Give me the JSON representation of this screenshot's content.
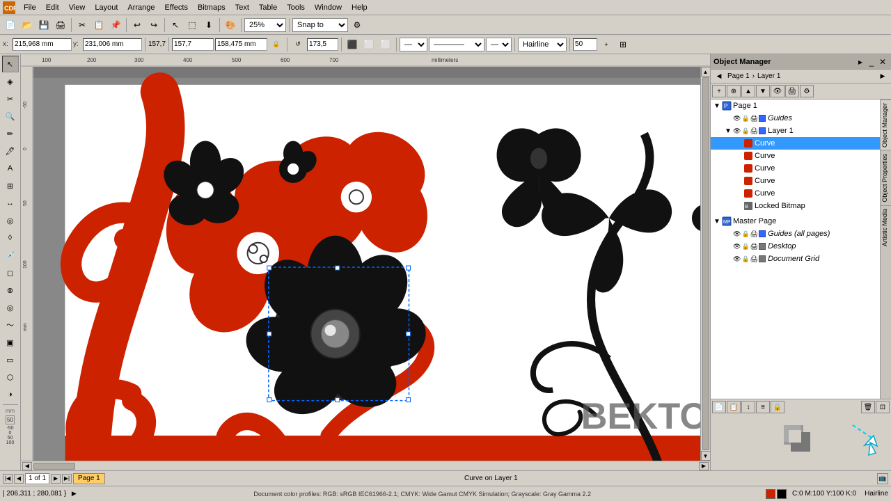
{
  "app": {
    "title": "CorelDRAW",
    "icon": "CDR"
  },
  "menu": {
    "items": [
      "File",
      "Edit",
      "View",
      "Layout",
      "Arrange",
      "Effects",
      "Bitmaps",
      "Text",
      "Table",
      "Tools",
      "Window",
      "Help"
    ]
  },
  "toolbar1": {
    "zoom_level": "25%",
    "snap_to": "Snap to"
  },
  "toolbar2": {
    "x_label": "x:",
    "y_label": "y:",
    "x_coord": "215,968 mm",
    "y_coord": "231,006 mm",
    "w_label": "157,7",
    "h_label": "158,475 mm",
    "w_value": "157,7",
    "h_value": "157,7",
    "rotation": "173,5",
    "hairline": "Hairline",
    "size_value": "50"
  },
  "canvas": {
    "background": "#ffffff"
  },
  "obj_manager": {
    "title": "Object Manager",
    "page_label": "Page 1",
    "layer_label": "Layer 1",
    "tree": {
      "page1": {
        "label": "Page 1",
        "children": {
          "guides": {
            "label": "Guides",
            "type": "guides"
          },
          "layer1": {
            "label": "Layer 1",
            "expanded": true,
            "children": {
              "curve1": {
                "label": "Curve",
                "selected": true,
                "type": "curve"
              },
              "curve2": {
                "label": "Curve",
                "type": "curve"
              },
              "curve3": {
                "label": "Curve",
                "type": "curve"
              },
              "curve4": {
                "label": "Curve",
                "type": "curve"
              },
              "curve5": {
                "label": "Curve",
                "type": "curve"
              },
              "lockedBitmap": {
                "label": "Locked Bitmap",
                "type": "bitmap"
              }
            }
          }
        }
      },
      "masterPage": {
        "label": "Master Page",
        "children": {
          "guidesAll": {
            "label": "Guides (all pages)",
            "type": "guides"
          },
          "desktop": {
            "label": "Desktop",
            "type": "layer"
          },
          "docGrid": {
            "label": "Document Grid",
            "type": "layer"
          }
        }
      }
    }
  },
  "status": {
    "coords": "| 206,311 ; 280,081 }",
    "object_info": "Curve on Layer 1",
    "color_profile": "Document color profiles: RGB: sRGB IEC61966-2.1; CMYK: Wide Gamut CMYK Simulation; Grayscale: Gray Gamma 2.2",
    "color_values": "C:0 M:100 Y:100 K:0",
    "nib": "Hairline"
  },
  "page_nav": {
    "current": "1 of 1",
    "page_label": "Page 1"
  },
  "watermark": "BEKTOP OM",
  "side_tabs": [
    "Object Properties",
    "Object Manager",
    "Artistic Media"
  ]
}
